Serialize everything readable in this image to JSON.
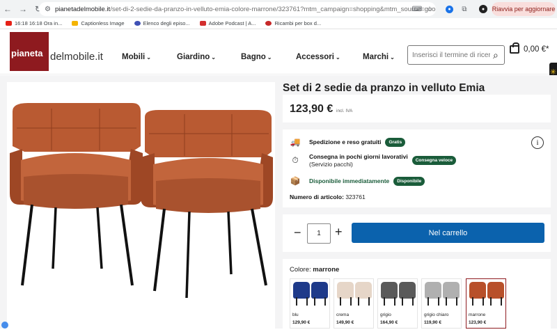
{
  "browser": {
    "url_host": "pianetadelmobile.it",
    "url_path": "/set-di-2-sedie-da-pranzo-in-velluto-emia-colore-marrone/323761?mtm_campaign=shopping&mtm_source=googl...",
    "relaunch_label": "Riavvia per aggiornare"
  },
  "bookmarks": [
    {
      "label": "16:18 16:18 Ora in...",
      "color": "#e62117"
    },
    {
      "label": "Captionless Image",
      "color": "#f4b400"
    },
    {
      "label": "Elenco degli episo...",
      "color": "#3f51b5"
    },
    {
      "label": "Adobe Podcast | A...",
      "color": "#d32f2f"
    },
    {
      "label": "Ricambi per box d...",
      "color": "#c62828"
    }
  ],
  "site": {
    "logo_part1": "pianeta",
    "logo_part2": "delmobile.it",
    "nav": [
      "Mobili",
      "Giardino",
      "Bagno",
      "Accessori",
      "Marchi"
    ],
    "search_placeholder": "Inserisci il termine di ricerca",
    "cart_total": "0,00 €*"
  },
  "product": {
    "title": "Set di 2 sedie da pranzo in velluto Emia",
    "price": "123,90 €",
    "vat_note": "incl. IVA",
    "shipping_label": "Spedizione e reso gratuiti",
    "shipping_badge": "Gratis",
    "delivery_label": "Consegna in pochi giorni lavorativi",
    "delivery_sub": "(Servizio pacchi)",
    "delivery_badge": "Consegna veloce",
    "availability_label": "Disponibile immediatamente",
    "availability_badge": "Disponibile",
    "article_label": "Numero di articolo:",
    "article_number": "323761",
    "quantity": "1",
    "add_to_cart": "Nel carrello",
    "color_label": "Colore:",
    "color_selected": "marrone",
    "variants": [
      {
        "name": "blu",
        "price": "129,90 €",
        "color": "#1e3a8a"
      },
      {
        "name": "crema",
        "price": "149,90 €",
        "color": "#e6d6c8"
      },
      {
        "name": "grigio",
        "price": "164,90 €",
        "color": "#5a5a5a"
      },
      {
        "name": "grigio chiaro",
        "price": "119,90 €",
        "color": "#b0b0b0"
      },
      {
        "name": "marrone",
        "price": "123,90 €",
        "color": "#b8502a"
      }
    ]
  }
}
